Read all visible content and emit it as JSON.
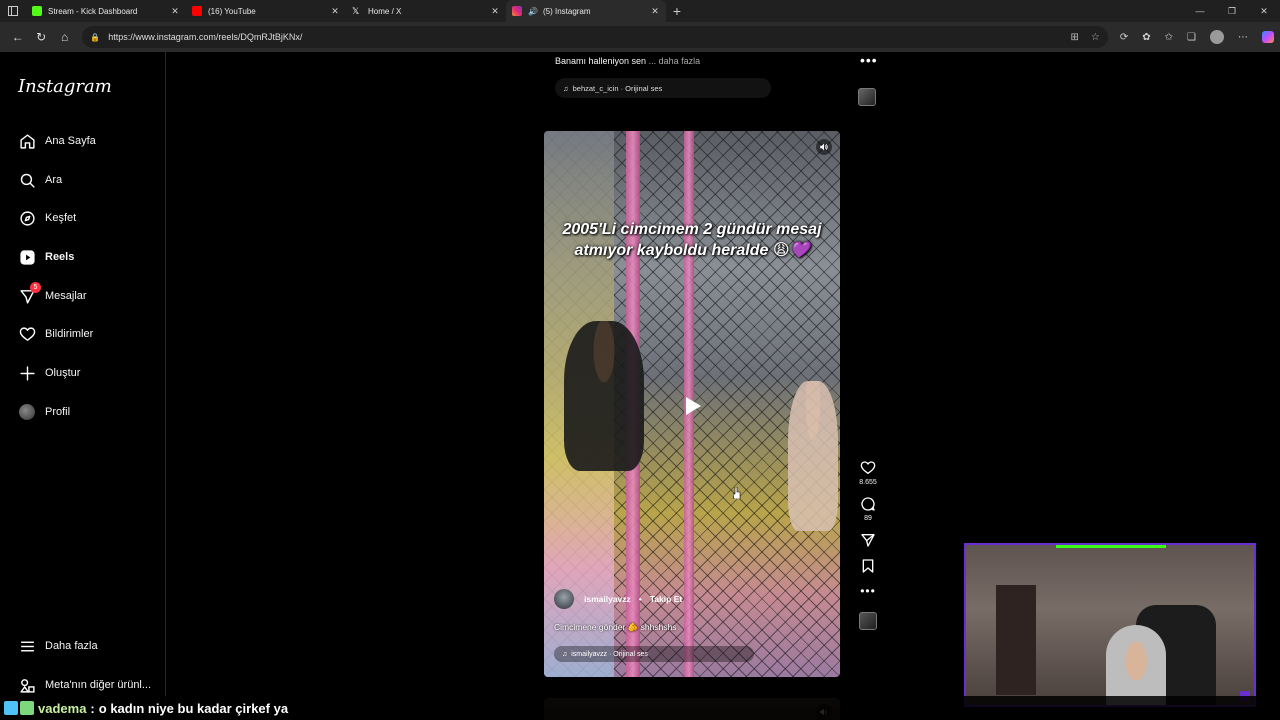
{
  "browser": {
    "tabs": [
      {
        "title": "Stream - Kick Dashboard",
        "favicon_color": "#53fc18"
      },
      {
        "title": "(16) YouTube",
        "favicon_color": "#ff0000"
      },
      {
        "title": "Home / X",
        "favicon_color": "#ffffff"
      },
      {
        "title": "(5) Instagram",
        "favicon_color": "#e1306c"
      }
    ],
    "url": "https://www.instagram.com/reels/DQmRJtBjKNx/"
  },
  "sidebar": {
    "logo": "Instagram",
    "items": [
      {
        "label": "Ana Sayfa"
      },
      {
        "label": "Ara"
      },
      {
        "label": "Keşfet"
      },
      {
        "label": "Reels"
      },
      {
        "label": "Mesajlar",
        "badge": "5"
      },
      {
        "label": "Bildirimler"
      },
      {
        "label": "Oluştur"
      },
      {
        "label": "Profil"
      }
    ],
    "more": "Daha fazla",
    "meta": "Meta'nın diğer ürünl..."
  },
  "prev_reel": {
    "caption": "Banamı halleniyon sen",
    "more": "... daha fazla",
    "audio": "behzat_c_icin · Orijinal ses"
  },
  "reel": {
    "overlay_text": "2005'Li cimcimem 2 gündür mesaj atmıyor kayboldu heralde 😩💜",
    "author": "ismailyavzz",
    "follow": "Takip Et",
    "separator": "•",
    "caption": "Cimcimene gönder 🫵 shhshshs",
    "audio": "ismailyavzz · Orijinal ses",
    "likes": "8.655",
    "comments": "89"
  },
  "chat": {
    "user": "vadema",
    "colon": ":",
    "message": "o kadın niye bu kadar çirkef ya"
  }
}
